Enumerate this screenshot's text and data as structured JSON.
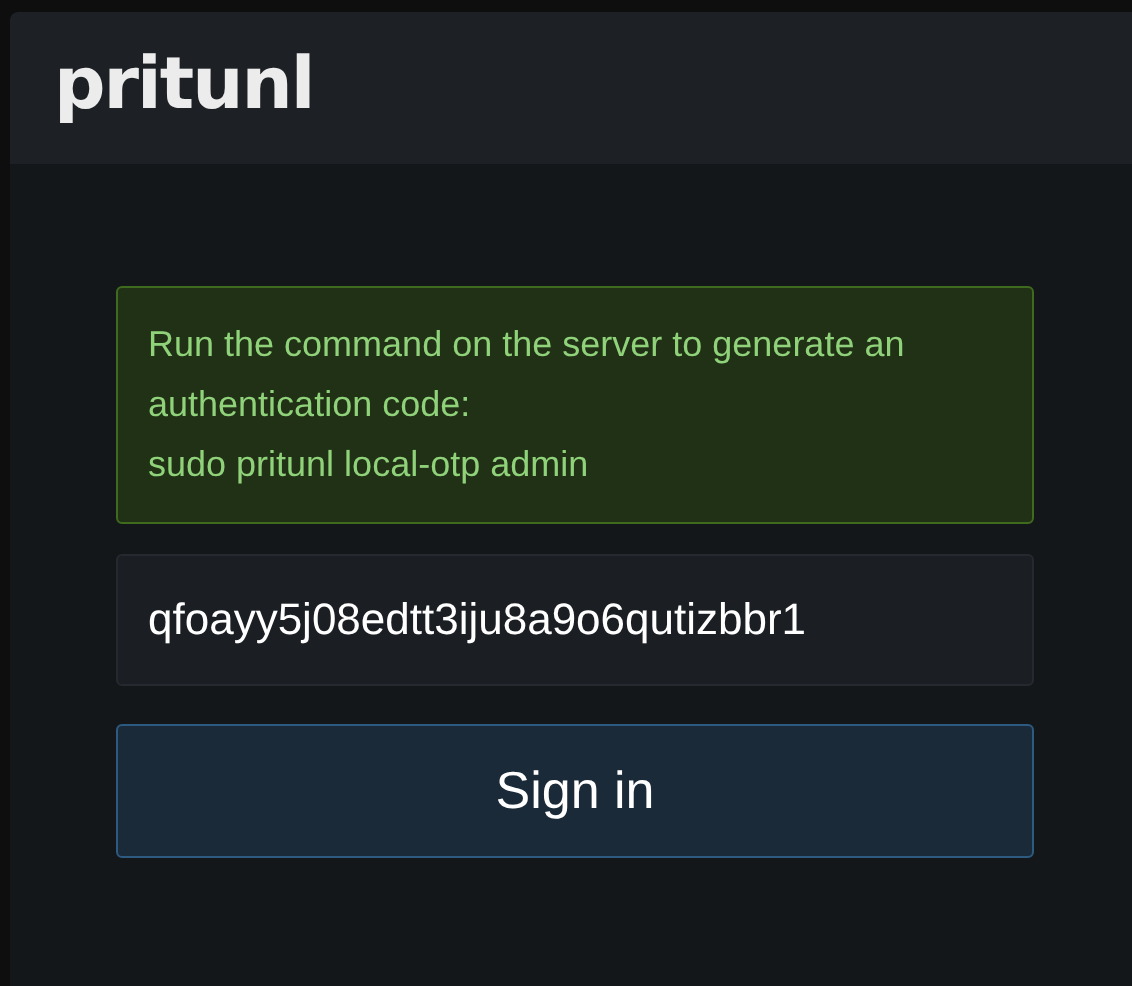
{
  "header": {
    "logo": "pritunl"
  },
  "notice": {
    "message": "Run the command on the server to generate an authentication code:",
    "command": "sudo pritunl local-otp admin"
  },
  "token_field": {
    "value": "qfoayy5j08edtt3iju8a9o6qutizbbr1"
  },
  "sign_in_button": {
    "label": "Sign in"
  }
}
